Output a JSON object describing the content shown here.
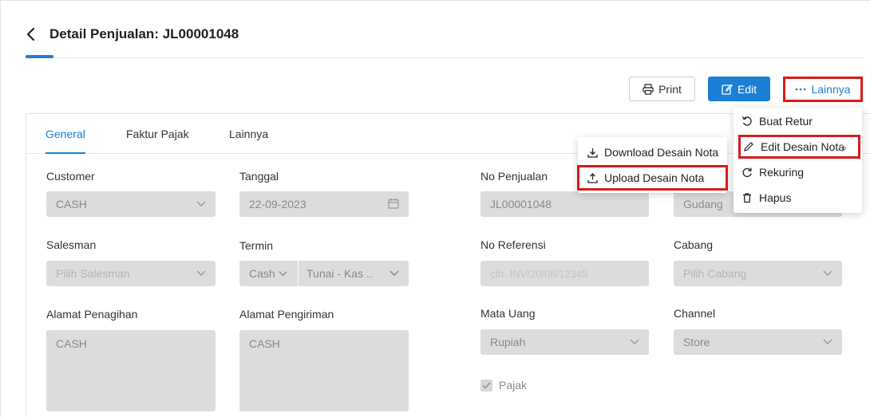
{
  "header": {
    "title": "Detail Penjualan: JL00001048"
  },
  "toolbar": {
    "print_label": "Print",
    "edit_label": "Edit",
    "more_label": "Lainnya"
  },
  "tabs": [
    {
      "label": "General",
      "active": true
    },
    {
      "label": "Faktur Pajak",
      "active": false
    },
    {
      "label": "Lainnya",
      "active": false
    }
  ],
  "form": {
    "customer": {
      "label": "Customer",
      "value": "CASH"
    },
    "tanggal": {
      "label": "Tanggal",
      "value": "22-09-2023"
    },
    "no_penjualan": {
      "label": "No Penjualan",
      "value": "JL00001048"
    },
    "gudang": {
      "value": "Gudang"
    },
    "salesman": {
      "label": "Salesman",
      "placeholder": "Pilih Salesman"
    },
    "termin": {
      "label": "Termin",
      "value": "Cash",
      "account": "Tunai - Kas .."
    },
    "no_referensi": {
      "label": "No Referensi",
      "placeholder": "cth. INV/20/08/12345"
    },
    "cabang": {
      "label": "Cabang",
      "placeholder": "Pilih Cabang"
    },
    "alamat_penagihan": {
      "label": "Alamat Penagihan",
      "value": "CASH"
    },
    "alamat_pengiriman": {
      "label": "Alamat Pengiriman",
      "value": "CASH"
    },
    "mata_uang": {
      "label": "Mata Uang",
      "value": "Rupiah"
    },
    "channel": {
      "label": "Channel",
      "value": "Store"
    },
    "pajak": {
      "label": "Pajak",
      "checked": true
    }
  },
  "more_menu": {
    "items": [
      {
        "label": "Buat Retur",
        "icon": "undo-icon"
      },
      {
        "label": "Edit Desain Nota",
        "icon": "pencil-icon",
        "highlighted": true
      },
      {
        "label": "Rekuring",
        "icon": "refresh-icon"
      },
      {
        "label": "Hapus",
        "icon": "trash-icon"
      }
    ]
  },
  "submenu": {
    "items": [
      {
        "label": "Download Desain Nota",
        "icon": "download-icon"
      },
      {
        "label": "Upload Desain Nota",
        "icon": "upload-icon",
        "highlighted": true
      }
    ]
  },
  "colors": {
    "accent": "#1a7fd6",
    "highlight_border": "#d81b1b",
    "disabled_field": "#dcdcdc"
  }
}
